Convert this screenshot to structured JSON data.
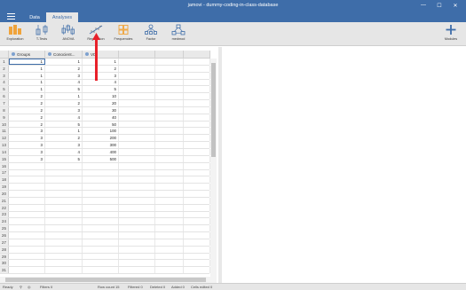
{
  "window": {
    "title": "jamovi - dummy-coding-in-class-database",
    "minimize": "—",
    "maximize": "☐",
    "close": "✕"
  },
  "tabs": [
    {
      "label": "Data"
    },
    {
      "label": "Analyses"
    }
  ],
  "ribbon": {
    "buttons": [
      {
        "label": "Exploration",
        "icon": "exploration-icon"
      },
      {
        "label": "T-Tests",
        "icon": "t-tests-icon"
      },
      {
        "label": "ANOVA",
        "icon": "anova-icon"
      },
      {
        "label": "Regression",
        "icon": "regression-icon"
      },
      {
        "label": "Frequencies",
        "icon": "frequencies-icon"
      },
      {
        "label": "Factor",
        "icon": "factor-icon"
      },
      {
        "label": "medmod",
        "icon": "medmod-icon"
      }
    ],
    "modules": {
      "label": "Modules",
      "icon": "plus-icon"
    }
  },
  "sheet": {
    "columns": [
      "Groups",
      "Conocient...",
      "VD"
    ],
    "rows": [
      [
        "1",
        "1",
        "1"
      ],
      [
        "1",
        "2",
        "2"
      ],
      [
        "1",
        "3",
        "3"
      ],
      [
        "1",
        "4",
        "4"
      ],
      [
        "1",
        "5",
        "5"
      ],
      [
        "2",
        "1",
        "10"
      ],
      [
        "2",
        "2",
        "20"
      ],
      [
        "2",
        "3",
        "30"
      ],
      [
        "2",
        "4",
        "40"
      ],
      [
        "2",
        "5",
        "50"
      ],
      [
        "3",
        "1",
        "100"
      ],
      [
        "3",
        "2",
        "200"
      ],
      [
        "3",
        "3",
        "300"
      ],
      [
        "3",
        "4",
        "400"
      ],
      [
        "3",
        "5",
        "500"
      ]
    ],
    "row_numbers": [
      "1",
      "2",
      "3",
      "4",
      "5",
      "6",
      "7",
      "8",
      "9",
      "10",
      "11",
      "12",
      "13",
      "14",
      "15",
      "16",
      "17",
      "18",
      "19",
      "20",
      "21",
      "22",
      "23",
      "24",
      "25",
      "26",
      "27",
      "28",
      "29",
      "30",
      "31"
    ]
  },
  "status": {
    "ready": "Ready",
    "filters": "Filters 0",
    "row_count": "Row count 15",
    "filtered": "Filtered 0",
    "deleted": "Deleted 0",
    "added": "Added 0",
    "cells_edited": "Cells edited 0"
  },
  "colors": {
    "accent": "#3e6da9",
    "ribbon_bg": "#e6e6e6",
    "arrow": "#e8202a",
    "icon_orange": "#f0a33a",
    "icon_blue": "#3e6da9"
  }
}
